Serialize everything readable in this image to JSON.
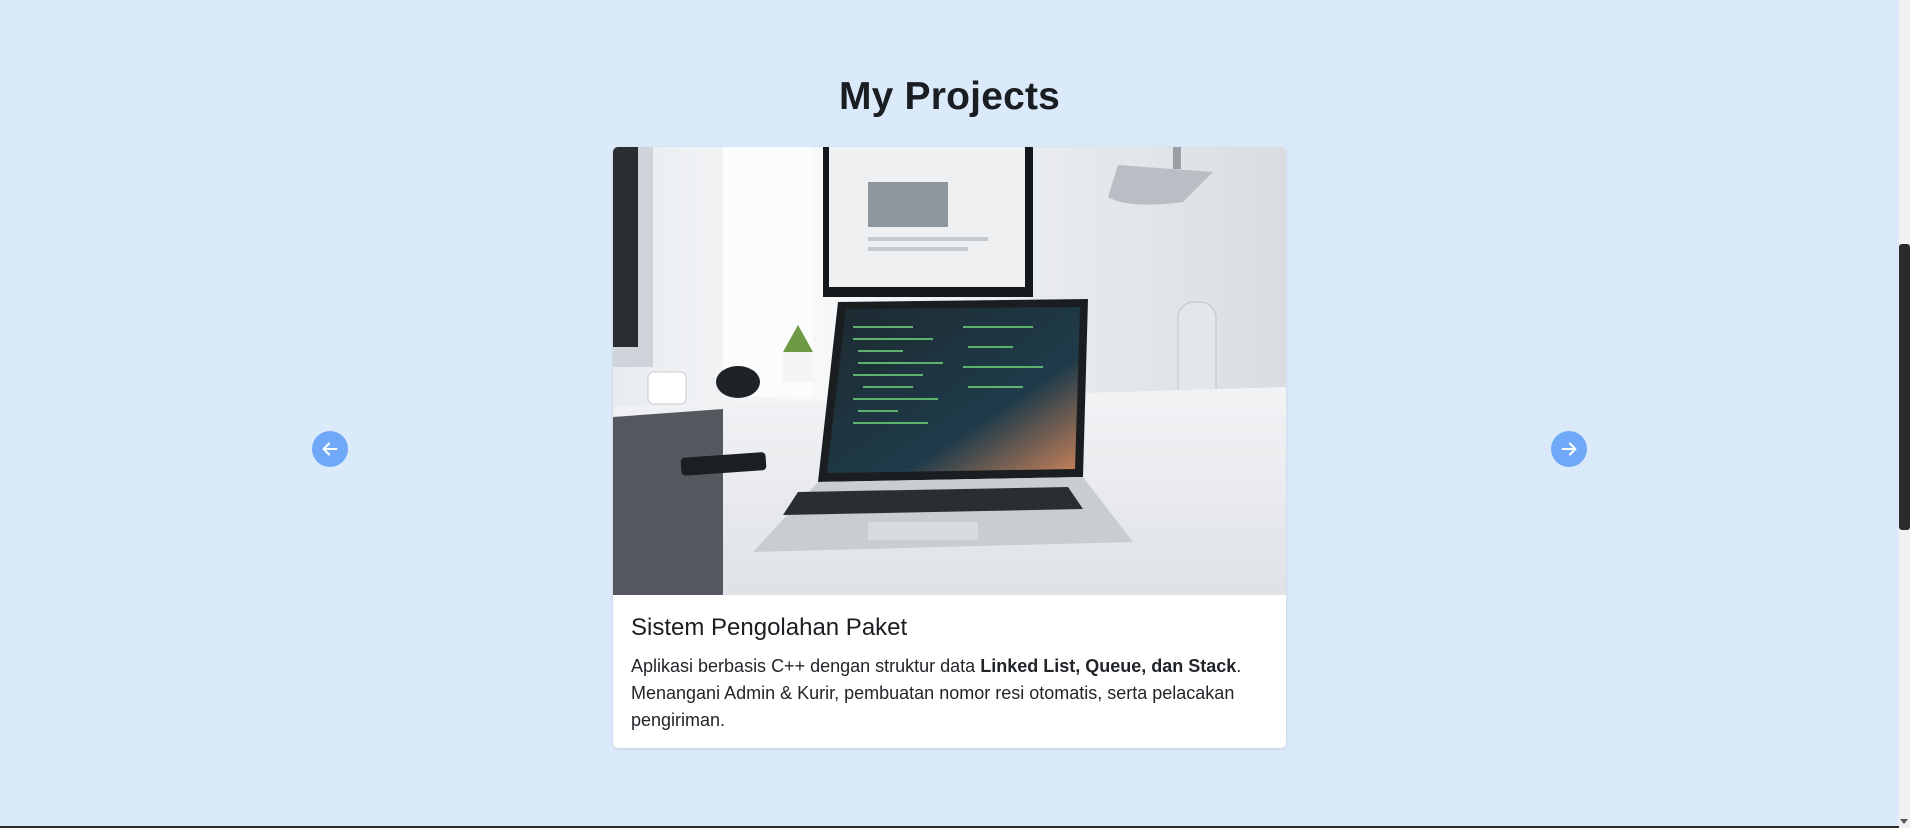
{
  "section": {
    "title": "My Projects"
  },
  "carousel": {
    "prev_icon": "arrow-left-icon",
    "next_icon": "arrow-right-icon",
    "button_color": "#6ea8f7"
  },
  "project": {
    "image_alt": "laptop-on-desk-image",
    "title": "Sistem Pengolahan Paket",
    "desc_part1": "Aplikasi berbasis C++ dengan struktur data ",
    "desc_bold": "Linked List, Queue, dan Stack",
    "desc_part2": ". Menangani Admin & Kurir, pembuatan nomor resi otomatis, serta pelacakan pengiriman."
  },
  "colors": {
    "background": "#dbeafb",
    "card": "#ffffff",
    "text": "#1a1d21"
  }
}
